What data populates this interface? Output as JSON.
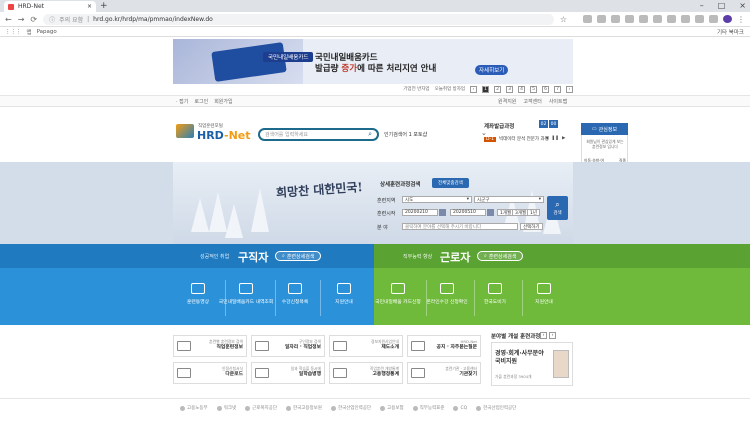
{
  "browser": {
    "tab_title": "HRD-Net",
    "new_tab": "+",
    "url_warning": "주의 요함",
    "url": "hrd.go.kr/hrdp/ma/pmmao/indexNew.do",
    "bookmark_apps": "앱",
    "bookmark_papago": "Papago",
    "bookmark_other": "기타 북마크"
  },
  "banner": {
    "card_label": "국민내일배움카드",
    "line1": "국민내일배움카드",
    "line2_pre": "발급량 ",
    "line2_hl": "증가",
    "line2_post": "에 따른 처리지연 안내",
    "detail_btn": "자세히보기",
    "pager_label1": "기업전 반자업",
    "pager_label2": "오늘취업 방자업",
    "pages": [
      "1",
      "2",
      "3",
      "4",
      "5",
      "6",
      "7"
    ]
  },
  "util": {
    "left": [
      "· 접기",
      "로그인",
      "회원가입"
    ],
    "right": [
      "원격지원",
      "고객센터",
      "사이트맵"
    ]
  },
  "header": {
    "logo_sub": "직업훈련포털",
    "logo_main_a": "HRD",
    "logo_main_b": "-Net",
    "search_placeholder": "검색어를 입력하세요",
    "popular": "인기검색어",
    "popular_item": "1 포토샵",
    "recommend_title": "계좌발급과정",
    "recommend_tabs": [
      "02",
      "00"
    ],
    "recommend_badge": "D-1",
    "recommend_text": "빅데이터 분석 전문가 과정"
  },
  "right_panel": {
    "title": "관심정보",
    "desc": "회원님이 관심있게 보는 훈련정보 입니다",
    "row1": [
      "이동·숙박·여",
      "직종"
    ],
    "row2": [
      "서울",
      "지역"
    ],
    "btn1": "훈련보기",
    "btn2": "초기화"
  },
  "search_area": {
    "slogan": "희망찬 대한민국!",
    "title": "상세훈련과정검색",
    "detail_btn": "전체맞춤검색",
    "region_label": "훈련지역",
    "region_sido": "시도",
    "region_sigungu": "시군구",
    "period_label": "훈련시작",
    "date_from": "20200210",
    "date_to": "20200510",
    "quick": [
      "1개월",
      "3개월",
      "1년"
    ],
    "field_label": "분 야",
    "field_placeholder": "클릭하여 분야를 선택해 주시기 바랍니다",
    "field_btn": "선택하기",
    "search_btn": "검색"
  },
  "jobseeker": {
    "sub": "성공적인 취업",
    "title": "구직자",
    "btn": "훈련상세검색",
    "items": [
      "훈련동영상",
      "국민내일배움카드 내역조회",
      "수강신청목록",
      "지원안내"
    ]
  },
  "worker": {
    "sub": "직무능력 향상",
    "title": "근로자",
    "btn": "훈련상세검색",
    "items": [
      "국민내일배움 카드신청",
      "온라인수강 신청확인",
      "한국도비가",
      "지원안내"
    ]
  },
  "quick": [
    {
      "s": "훈련별 훈련정보 검색",
      "m": "직업훈련정보"
    },
    {
      "s": "구인정보 검색",
      "m": "일자리 · 직업정보"
    },
    {
      "s": "경보지원사업안내",
      "m": "제도소개"
    },
    {
      "s": "HRD-Net",
      "m": "공지 · 자주묻는질문"
    },
    {
      "s": "인정신청서식",
      "m": "다운로드"
    },
    {
      "s": "일과 학습을 동시에",
      "m": "일학습병행"
    },
    {
      "s": "직업훈련 개방통계",
      "m": "고용행정통계"
    },
    {
      "s": "훈련기관 · 고용센터",
      "m": "기관찾기"
    }
  ],
  "new_course": {
    "title": "분야별 개설 훈련과정",
    "text": "경영·회계·사무분야 국비지원",
    "sub": "가을 훈련과정 3904개"
  },
  "footer": {
    "logos": [
      "고용노동부",
      "워크넷",
      "근로복지공단",
      "한국고용정보원",
      "한국산업인력공단",
      "고용보험",
      "직무능력표준",
      "CQ",
      "한국산업인력공단"
    ]
  }
}
